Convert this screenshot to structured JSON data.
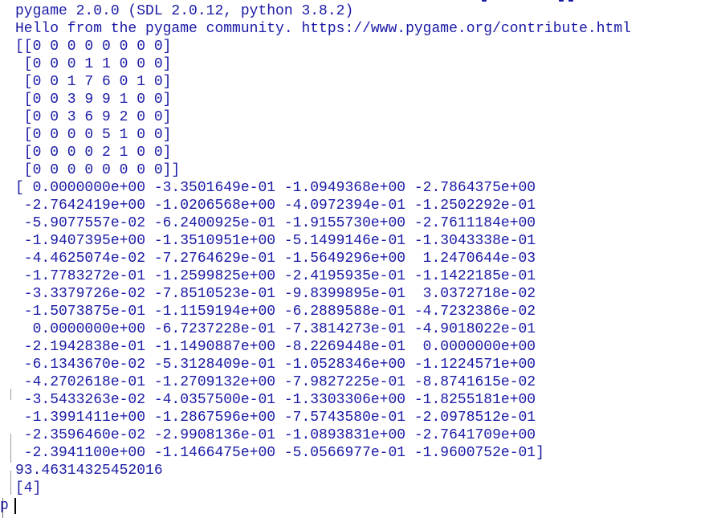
{
  "console": {
    "lines": [
      "pygame 2.0.0 (SDL 2.0.12, python 3.8.2)",
      "Hello from the pygame community. https://www.pygame.org/contribute.html",
      "[[0 0 0 0 0 0 0 0]",
      " [0 0 0 1 1 0 0 0]",
      " [0 0 1 7 6 0 1 0]",
      " [0 0 3 9 9 1 0 0]",
      " [0 0 3 6 9 2 0 0]",
      " [0 0 0 0 5 1 0 0]",
      " [0 0 0 0 2 1 0 0]",
      " [0 0 0 0 0 0 0 0]]",
      "[ 0.0000000e+00 -3.3501649e-01 -1.0949368e+00 -2.7864375e+00",
      " -2.7642419e+00 -1.0206568e+00 -4.0972394e-01 -1.2502292e-01",
      " -5.9077557e-02 -6.2400925e-01 -1.9155730e+00 -2.7611184e+00",
      " -1.9407395e+00 -1.3510951e+00 -5.1499146e-01 -1.3043338e-01",
      " -4.4625074e-02 -7.2764629e-01 -1.5649296e+00  1.2470644e-03",
      " -1.7783272e-01 -1.2599825e+00 -2.4195935e-01 -1.1422185e-01",
      " -3.3379726e-02 -7.8510523e-01 -9.8399895e-01  3.0372718e-02",
      " -1.5073875e-01 -1.1159194e+00 -6.2889588e-01 -4.7232386e-02",
      "  0.0000000e+00 -6.7237228e-01 -7.3814273e-01 -4.9018022e-01",
      " -2.1942838e-01 -1.1490887e+00 -8.2269448e-01  0.0000000e+00",
      " -6.1343670e-02 -5.3128409e-01 -1.0528346e+00 -1.1224571e+00",
      " -4.2702618e-01 -1.2709132e+00 -7.9827225e-01 -8.8741615e-02",
      " -3.5433263e-02 -4.0357500e-01 -1.3303306e+00 -1.8255181e+00",
      " -1.3991411e+00 -1.2867596e+00 -7.5743580e-01 -2.0978512e-01",
      " -2.3596460e-02 -2.9908136e-01 -1.0893831e+00 -2.7641709e+00",
      " -2.3941100e+00 -1.1466475e+00 -5.0566977e-01 -1.9600752e-01]",
      "93.46314325452016",
      "[4]"
    ],
    "prompt_text": "p"
  },
  "colors": {
    "output_text": "#1a1aa6",
    "background": "#ffffff",
    "cursor": "#000000"
  }
}
